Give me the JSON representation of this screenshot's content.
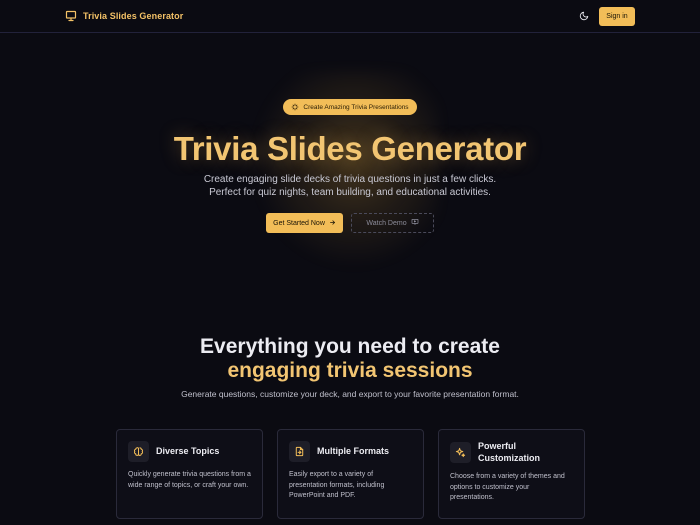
{
  "header": {
    "brand_name": "Trivia Slides Generator",
    "signin_label": "Sign in"
  },
  "hero": {
    "badge_label": "Create Amazing Trivia Presentations",
    "title": "Trivia Slides Generator",
    "subtitle_line1": "Create engaging slide decks of trivia questions in just a few clicks.",
    "subtitle_line2": "Perfect for quiz nights, team building, and educational activities.",
    "primary_cta": "Get Started Now",
    "secondary_cta": "Watch Demo"
  },
  "features": {
    "title_line1": "Everything you need to create",
    "title_line2": "engaging trivia sessions",
    "subtitle": "Generate questions, customize your deck, and export to your favorite presentation format.",
    "cards": [
      {
        "icon": "brain-icon",
        "title": "Diverse Topics",
        "description": "Quickly generate trivia questions from a wide range of topics, or craft your own."
      },
      {
        "icon": "file-export-icon",
        "title": "Multiple Formats",
        "description": "Easily export to a variety of presentation formats, including PowerPoint and PDF."
      },
      {
        "icon": "sparkles-icon",
        "title": "Powerful Customization",
        "description": "Choose from a variety of themes and options to customize your presentations."
      }
    ]
  },
  "colors": {
    "accent": "#f2bd58",
    "background": "#0b0b12",
    "heading_gold": "#f2c572"
  }
}
